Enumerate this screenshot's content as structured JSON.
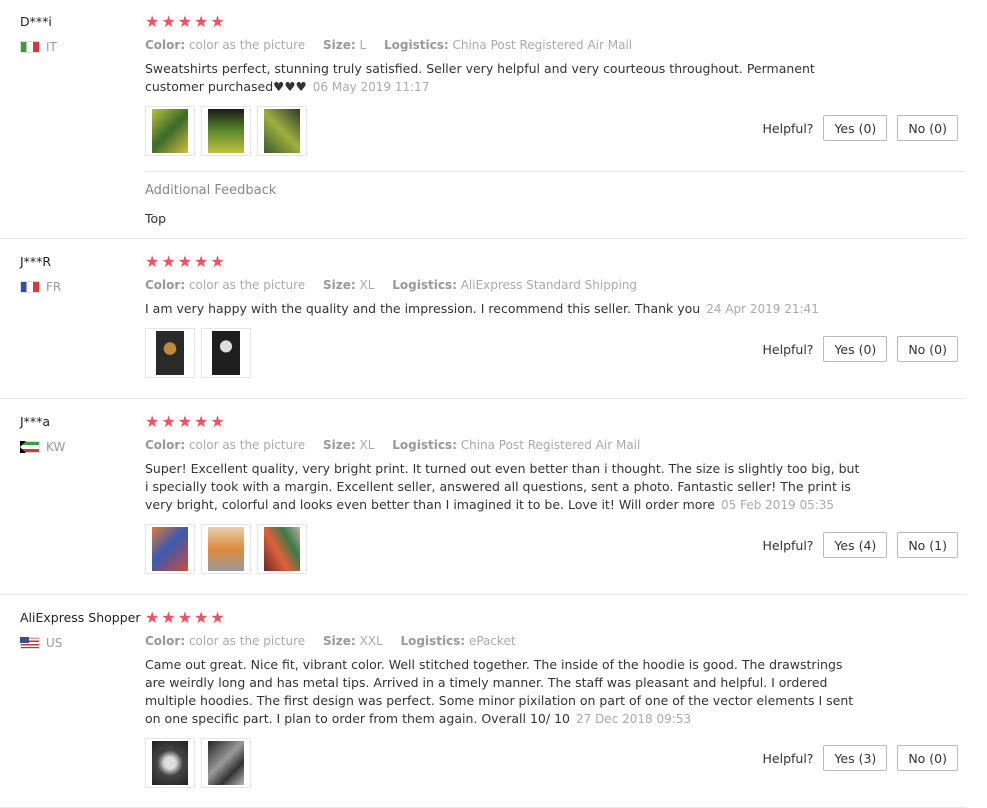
{
  "labels": {
    "color": "Color:",
    "size": "Size:",
    "logistics": "Logistics:",
    "helpful": "Helpful?",
    "additional_feedback": "Additional Feedback"
  },
  "reviews": [
    {
      "user": "D***i",
      "country": "IT",
      "stars": "★★★★★",
      "color": "color as the picture",
      "size": "L",
      "logistics": "China Post Registered Air Mail",
      "text": "Sweatshirts perfect, stunning truly satisfied. Seller very helpful and very courteous throughout. Permanent customer purchased♥♥♥",
      "date": "06 May 2019 11:17",
      "yes": "Yes (0)",
      "no": "No (0)",
      "additional_feedback": "Top",
      "thumb_colors": [
        "#6a8a2a",
        "#2c3a1c",
        "#5b7a30"
      ]
    },
    {
      "user": "J***R",
      "country": "FR",
      "stars": "★★★★★",
      "color": "color as the picture",
      "size": "XL",
      "logistics": "AliExpress Standard Shipping",
      "text": "I am very happy with the quality and the impression. I recommend this seller. Thank you",
      "date": "24 Apr 2019 21:41",
      "yes": "Yes (0)",
      "no": "No (0)",
      "thumb_colors": [
        "#2a2a2a",
        "#1e1e1e"
      ]
    },
    {
      "user": "J***a",
      "country": "KW",
      "stars": "★★★★★",
      "color": "color as the picture",
      "size": "XL",
      "logistics": "China Post Registered Air Mail",
      "text": "Super! Excellent quality, very bright print. It turned out even better than i thought. The size is slightly too big, but i specially took with a margin. Excellent seller, answered all questions, sent a photo. Fantastic seller! The print is very bright, colorful and looks even better than I imagined it to be. Love it! Will order more",
      "date": "05 Feb 2019 05:35",
      "yes": "Yes (4)",
      "no": "No (1)",
      "thumb_colors": [
        "#d0603a",
        "#c8a080",
        "#b04a3a"
      ]
    },
    {
      "user": "AliExpress Shopper",
      "country": "US",
      "stars": "★★★★★",
      "color": "color as the picture",
      "size": "XXL",
      "logistics": "ePacket",
      "text": "Came out great. Nice fit, vibrant color. Well stitched together. The inside of the hoodie is good. The drawstrings are weirdly long and has metal tips. Arrived in a timely manner. The staff was pleasant and helpful. I ordered multiple hoodies. The first design was perfect. Some minor pixilation on part of one of the vector elements I sent on one specific part. I plan to order from them again. Overall 10/ 10",
      "date": "27 Dec 2018 09:53",
      "yes": "Yes (3)",
      "no": "No (0)",
      "thumb_colors": [
        "#555555",
        "#3a3a3a"
      ]
    }
  ]
}
